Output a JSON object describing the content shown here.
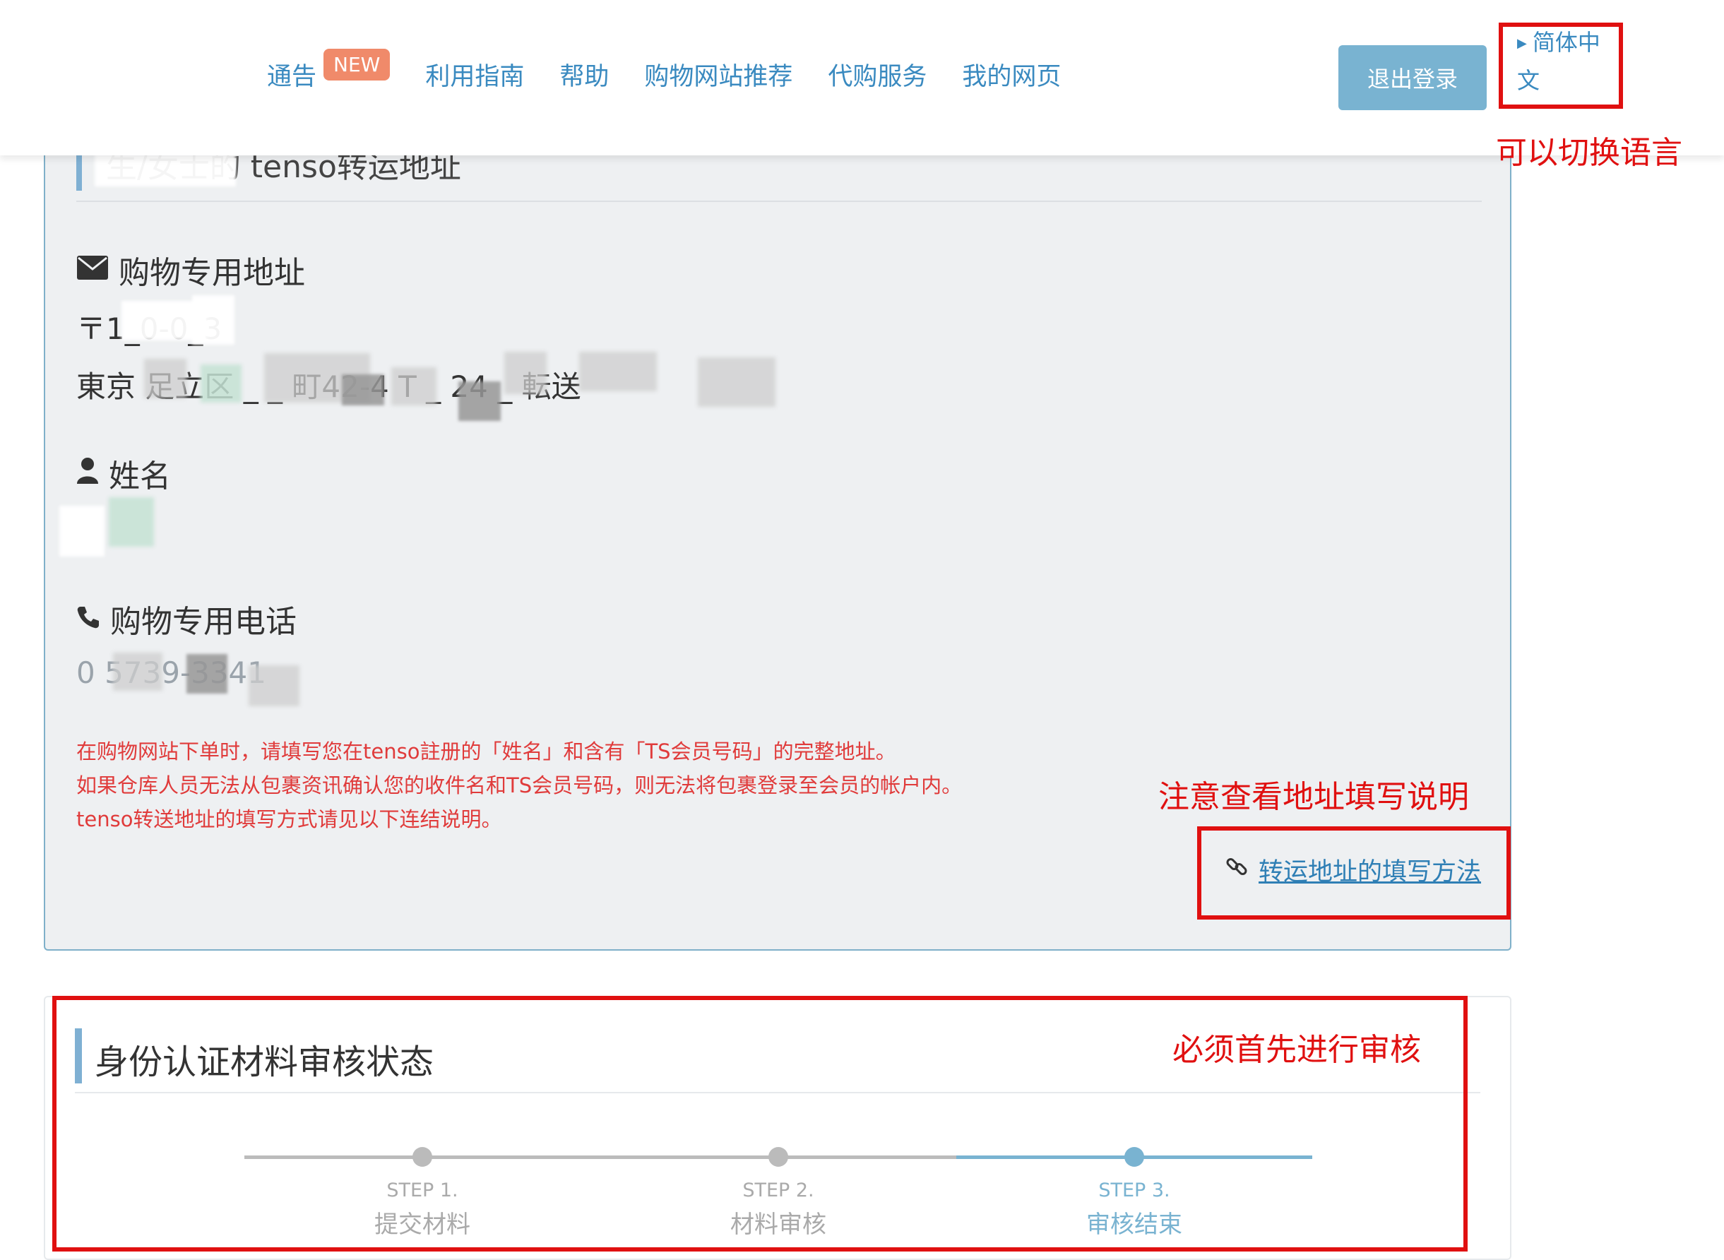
{
  "header": {
    "nav": [
      {
        "label": "通告"
      },
      {
        "label": "利用指南"
      },
      {
        "label": "帮助"
      },
      {
        "label": "购物网站推荐"
      },
      {
        "label": "代购服务"
      },
      {
        "label": "我的网页"
      }
    ],
    "new_badge": "NEW",
    "logout_label": "退出登录",
    "language_line1": "简体中",
    "language_line2": "文"
  },
  "annotations": {
    "language_note": "可以切换语言",
    "address_note": "注意查看地址填写说明",
    "review_note": "必须首先进行审核"
  },
  "address_panel": {
    "title": "生/女士的 tenso转运地址",
    "shopping_address_label": "购物专用地址",
    "postal_code": "〒1_0-0_3",
    "address_line": "東京 足立区 _ _ 町42-4 T _ 24 _ 転送",
    "name_label": "姓名",
    "phone_label": "购物专用电话",
    "phone_value": "0 5739-3341",
    "notice_lines": [
      "在购物网站下单时，请填写您在tenso註册的「姓名」和含有「TS会员号码」的完整地址。",
      "如果仓库人员无法从包裹资讯确认您的收件名和TS会员号码，则无法将包裹登录至会员的帐户内。",
      "tenso转送地址的填写方式请见以下连结说明。"
    ],
    "howto_link": "转运地址的填写方法"
  },
  "status_panel": {
    "title": "身份认证材料审核状态",
    "current_step": 3,
    "steps": [
      {
        "label": "STEP 1.",
        "name": "提交材料"
      },
      {
        "label": "STEP 2.",
        "name": "材料审核"
      },
      {
        "label": "STEP 3.",
        "name": "审核结束"
      }
    ]
  },
  "colors": {
    "accent": "#79b3d1",
    "link": "#3a8ac0",
    "annotation_red": "#e01010",
    "notice_red": "#e03b3b",
    "badge": "#f08a6a"
  }
}
